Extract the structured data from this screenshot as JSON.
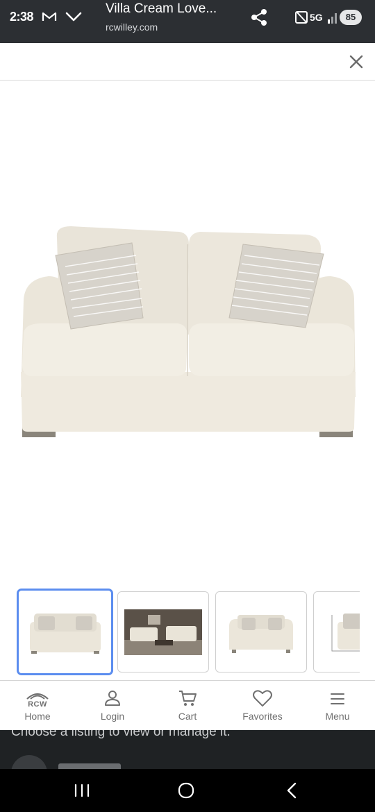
{
  "status_bar": {
    "time": "2:38",
    "network": "5G",
    "battery": "85"
  },
  "browser": {
    "title": "Villa Cream Love...",
    "domain": "rcwilley.com"
  },
  "gallery": {
    "active_index": 0,
    "thumbnail_count": 4
  },
  "site_nav": {
    "logo_text": "RCW",
    "items": [
      {
        "label": "Home",
        "icon": "rcw-home-icon"
      },
      {
        "label": "Login",
        "icon": "user-icon"
      },
      {
        "label": "Cart",
        "icon": "cart-icon"
      },
      {
        "label": "Favorites",
        "icon": "heart-icon"
      },
      {
        "label": "Menu",
        "icon": "hamburger-icon"
      }
    ]
  },
  "background_page": {
    "peek_text": "Choose a listing to view or manage it."
  },
  "colors": {
    "topbar": "#2c2f33",
    "active_thumb_border": "#5b8def",
    "nav_text": "#707070"
  }
}
